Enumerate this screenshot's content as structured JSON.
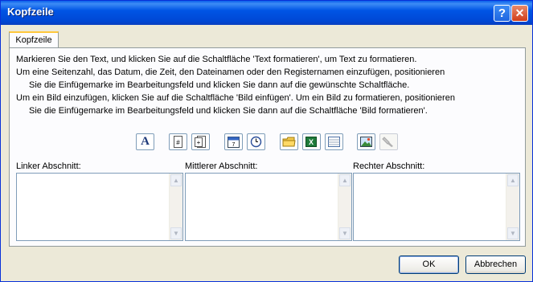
{
  "window": {
    "title": "Kopfzeile"
  },
  "titlebar": {
    "help_label": "?",
    "close_label": "✕"
  },
  "tab": {
    "label": "Kopfzeile"
  },
  "instructions": [
    "Markieren Sie den Text, und klicken Sie auf die Schaltfläche 'Text formatieren', um Text zu formatieren.",
    "Um eine Seitenzahl, das Datum, die Zeit, den Dateinamen oder den Registernamen einzufügen, positionieren",
    "Sie die Einfügemarke im Bearbeitungsfeld und klicken Sie dann auf die gewünschte Schaltfläche.",
    "Um ein Bild einzufügen, klicken Sie auf die Schaltfläche 'Bild einfügen'. Um ein Bild zu formatieren, positionieren",
    "Sie die Einfügemarke im Bearbeitungsfeld und klicken Sie dann auf die Schaltfläche 'Bild formatieren'."
  ],
  "toolbar": {
    "icons": [
      "format-text-icon",
      "page-number-icon",
      "page-count-icon",
      "date-icon",
      "time-icon",
      "file-path-icon",
      "file-name-icon",
      "sheet-name-icon",
      "insert-picture-icon",
      "format-picture-icon"
    ],
    "format_text_glyph": "A"
  },
  "sections": {
    "left": {
      "label": "Linker Abschnitt:",
      "value": ""
    },
    "center": {
      "label": "Mittlerer Abschnitt:",
      "value": ""
    },
    "right": {
      "label": "Rechter Abschnitt:",
      "value": ""
    }
  },
  "buttons": {
    "ok": "OK",
    "cancel": "Abbrechen"
  },
  "colors": {
    "titlebar": "#0055E5",
    "dialog_bg": "#ECE9D8",
    "panel_bg": "#FCFCFE",
    "tab_accent": "#FFC83C",
    "border": "#7F9DB9"
  }
}
